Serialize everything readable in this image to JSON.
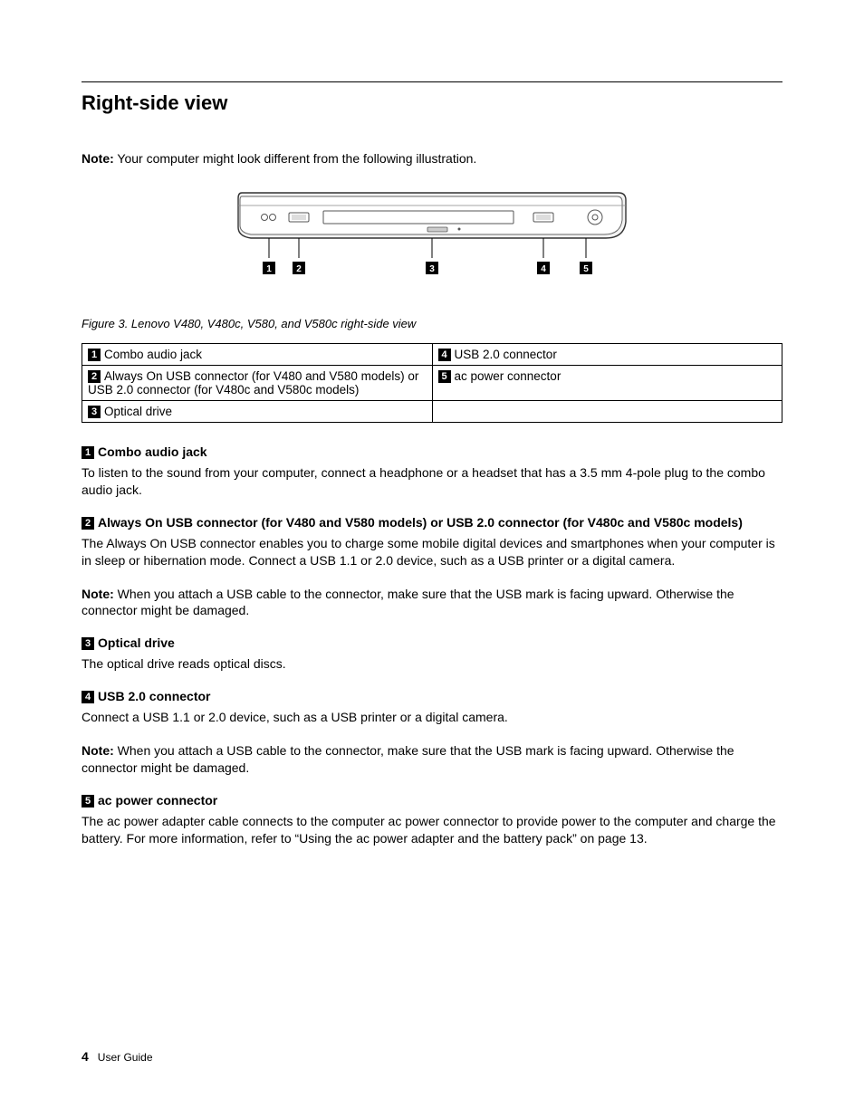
{
  "title": "Right-side view",
  "intro_note_prefix": "Note:",
  "intro_note_text": "Your computer might look different from the following illustration.",
  "figure_caption": "Figure 3.  Lenovo V480, V480c, V580, and V580c right-side view",
  "callouts": {
    "c1": {
      "num": "1",
      "label": "Combo audio jack"
    },
    "c2": {
      "num": "2",
      "label": "Always On USB connector (for V480 and V580 models) or USB 2.0 connector (for V480c and V580c models)"
    },
    "c3": {
      "num": "3",
      "label": "Optical drive"
    },
    "c4": {
      "num": "4",
      "label": "USB 2.0 connector"
    },
    "c5": {
      "num": "5",
      "label": "ac power connector"
    }
  },
  "sections": {
    "s1": {
      "num": "1",
      "heading": "Combo audio jack",
      "p1": "To listen to the sound from your computer, connect a headphone or a headset that has a 3.5 mm 4-pole plug to the combo audio jack."
    },
    "s2": {
      "num": "2",
      "heading": "Always On USB connector (for V480 and V580 models) or USB 2.0 connector (for V480c and V580c models)",
      "p1": "The Always On USB connector enables you to charge some mobile digital devices and smartphones when your computer is in sleep or hibernation mode.  Connect a USB 1.1 or 2.0 device, such as a USB printer or a digital camera.",
      "note_prefix": "Note:",
      "note_text": "When you attach a USB cable to the connector, make sure that the USB mark is facing upward. Otherwise the connector might be damaged."
    },
    "s3": {
      "num": "3",
      "heading": "Optical drive",
      "p1": "The optical drive reads optical discs."
    },
    "s4": {
      "num": "4",
      "heading": "USB 2.0 connector",
      "p1": "Connect a USB 1.1 or 2.0 device, such as a USB printer or a digital camera.",
      "note_prefix": "Note:",
      "note_text": "When you attach a USB cable to the connector, make sure that the USB mark is facing upward. Otherwise the connector might be damaged."
    },
    "s5": {
      "num": "5",
      "heading": "ac power connector",
      "p1": "The ac power adapter cable connects to the computer ac power connector to provide power to the computer and charge the battery.  For more information, refer to “Using the ac power adapter and the battery pack” on page 13."
    }
  },
  "figure_labels": {
    "l1": "1",
    "l2": "2",
    "l3": "3",
    "l4": "4",
    "l5": "5"
  },
  "footer": {
    "pagenum": "4",
    "text": "User Guide"
  }
}
